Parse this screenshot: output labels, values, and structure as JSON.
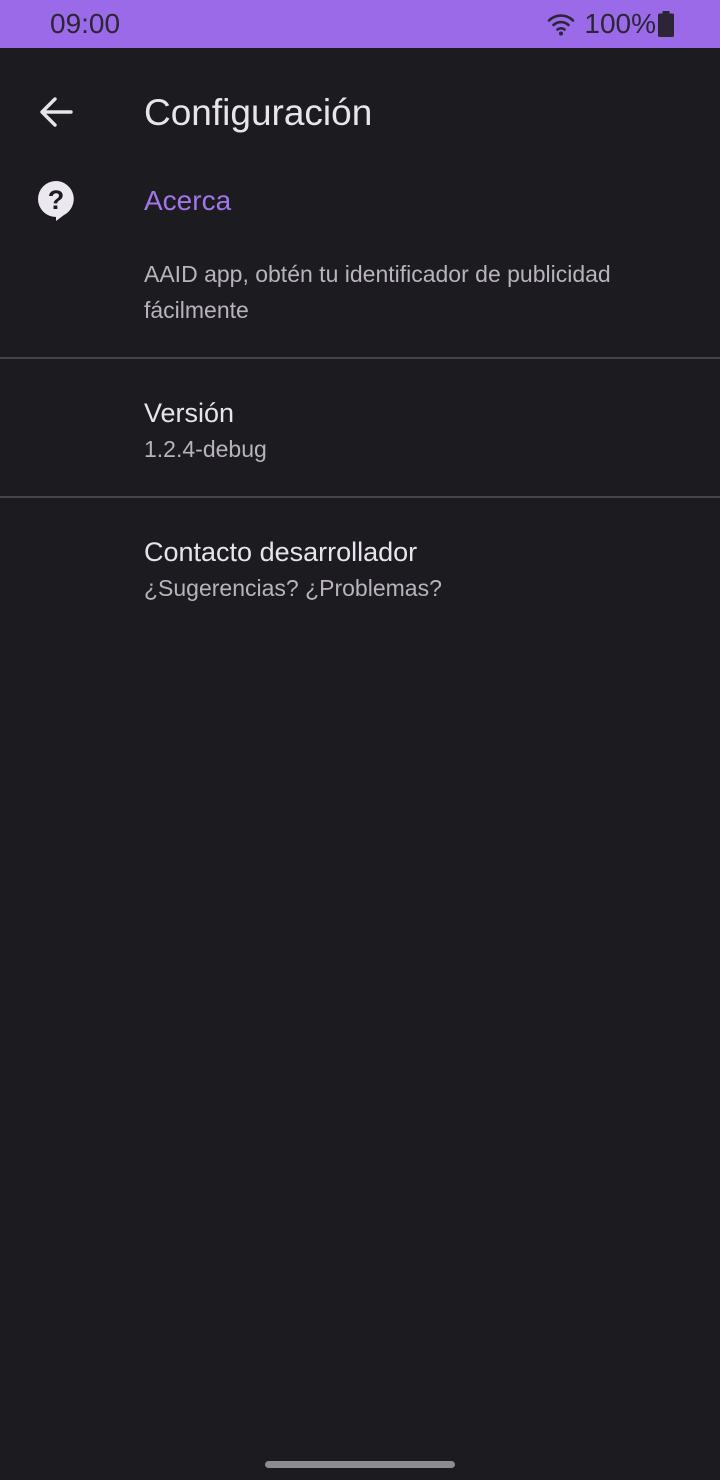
{
  "status_bar": {
    "time": "09:00",
    "battery": "100%",
    "icons": [
      "wifi-icon",
      "battery-icon"
    ],
    "color": "#9b6ae8"
  },
  "app_bar": {
    "back_icon": "arrow-back-icon",
    "title": "Configuración"
  },
  "about": {
    "icon": "help-icon",
    "header": "Acerca",
    "description": "AAID app, obtén tu identificador de publicidad fácilmente",
    "accent_color": "#a275e8"
  },
  "preferences": [
    {
      "title": "Versión",
      "summary": "1.2.4-debug"
    },
    {
      "title": "Contacto desarrollador",
      "summary": "¿Sugerencias? ¿Problemas?"
    }
  ],
  "theme": {
    "background": "#1c1b20",
    "text_primary": "#e8e4ec",
    "text_secondary": "#b8b3bd"
  }
}
